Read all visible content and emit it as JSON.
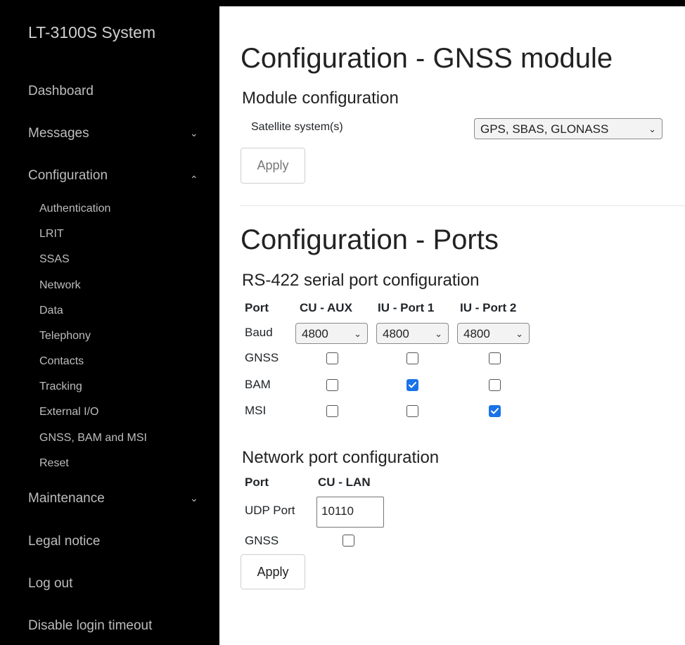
{
  "sidebar": {
    "brand": "LT-3100S System",
    "items": [
      {
        "label": "Dashboard"
      },
      {
        "label": "Messages",
        "chevron": "⌄"
      },
      {
        "label": "Configuration",
        "chevron": "⌃"
      },
      {
        "label": "Maintenance",
        "chevron": "⌄"
      },
      {
        "label": "Legal notice"
      },
      {
        "label": "Log out"
      },
      {
        "label": "Disable login timeout"
      }
    ],
    "config_sub": [
      "Authentication",
      "LRIT",
      "SSAS",
      "Network",
      "Data",
      "Telephony",
      "Contacts",
      "Tracking",
      "External I/O",
      "GNSS, BAM and MSI",
      "Reset"
    ]
  },
  "gnss": {
    "title": "Configuration - GNSS module",
    "subtitle": "Module configuration",
    "satellite_label": "Satellite system(s)",
    "satellite_value": "GPS, SBAS, GLONASS",
    "apply": "Apply"
  },
  "ports": {
    "title": "Configuration - Ports",
    "serial_subtitle": "RS-422 serial port configuration",
    "col_port": "Port",
    "cols": [
      "CU - AUX",
      "IU - Port 1",
      "IU - Port 2"
    ],
    "baud_label": "Baud",
    "baud_values": [
      "4800",
      "4800",
      "4800"
    ],
    "rows": [
      {
        "label": "GNSS",
        "checked": [
          false,
          false,
          false
        ]
      },
      {
        "label": "BAM",
        "checked": [
          false,
          true,
          false
        ]
      },
      {
        "label": "MSI",
        "checked": [
          false,
          false,
          true
        ]
      }
    ],
    "network_subtitle": "Network port configuration",
    "net_col": "CU - LAN",
    "udp_label": "UDP Port",
    "udp_value": "10110",
    "net_gnss_label": "GNSS",
    "net_gnss_checked": false,
    "apply": "Apply"
  },
  "colors": {
    "accent": "#1a73e8",
    "sidebar_bg": "#000000"
  },
  "icons": {
    "dropdown": "chevron-down-icon",
    "check": "checkmark-icon"
  }
}
